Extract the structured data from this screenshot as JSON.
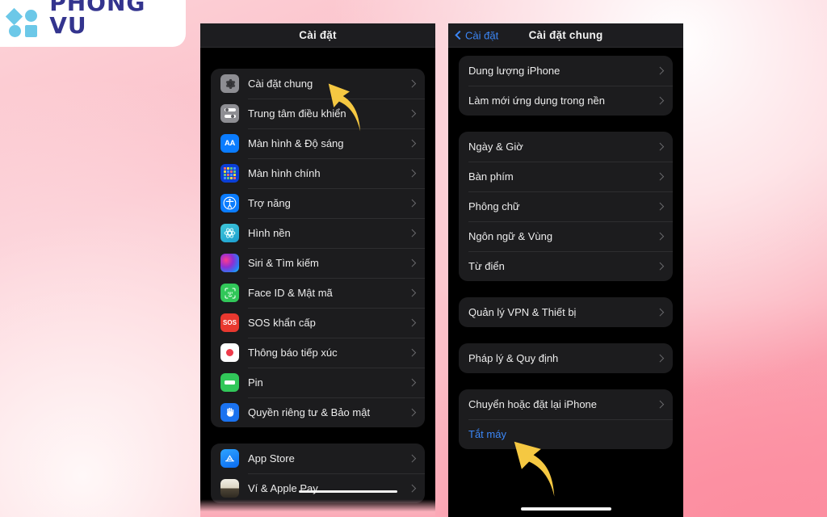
{
  "brand": {
    "name": "PHONG VU",
    "logo_icon": "phong-vu-logo",
    "logo_color": "#33348e",
    "shape_color": "#6cc8e8"
  },
  "background": {
    "gradient_from": "#fcd3d8",
    "gradient_to": "#fb8fa2"
  },
  "phone_left": {
    "nav": {
      "title": "Cài đặt"
    },
    "groups": [
      {
        "rows": [
          {
            "label": "Cài đặt chung",
            "icon": "gear-icon"
          },
          {
            "label": "Trung tâm điều khiển",
            "icon": "control-center-icon"
          },
          {
            "label": "Màn hình & Độ sáng",
            "icon": "display-brightness-icon"
          },
          {
            "label": "Màn hình chính",
            "icon": "home-screen-icon"
          },
          {
            "label": "Trợ năng",
            "icon": "accessibility-icon"
          },
          {
            "label": "Hình nền",
            "icon": "wallpaper-icon"
          },
          {
            "label": "Siri & Tìm kiếm",
            "icon": "siri-icon"
          },
          {
            "label": "Face ID & Mật mã",
            "icon": "face-id-icon"
          },
          {
            "label": "SOS khẩn cấp",
            "icon": "sos-icon"
          },
          {
            "label": "Thông báo tiếp xúc",
            "icon": "exposure-notification-icon"
          },
          {
            "label": "Pin",
            "icon": "battery-icon"
          },
          {
            "label": "Quyền riêng tư & Bảo mật",
            "icon": "privacy-icon"
          }
        ]
      },
      {
        "rows": [
          {
            "label": "App Store",
            "icon": "app-store-icon"
          },
          {
            "label": "Ví & Apple Pay",
            "icon": "wallet-icon"
          }
        ]
      }
    ]
  },
  "phone_right": {
    "nav": {
      "back_label": "Cài đặt",
      "title": "Cài đặt chung"
    },
    "groups": [
      {
        "rows": [
          {
            "label": "Dung lượng iPhone"
          },
          {
            "label": "Làm mới ứng dụng trong nền"
          }
        ]
      },
      {
        "rows": [
          {
            "label": "Ngày & Giờ"
          },
          {
            "label": "Bàn phím"
          },
          {
            "label": "Phông chữ"
          },
          {
            "label": "Ngôn ngữ & Vùng"
          },
          {
            "label": "Từ điển"
          }
        ]
      },
      {
        "rows": [
          {
            "label": "Quản lý VPN & Thiết bị"
          }
        ]
      },
      {
        "rows": [
          {
            "label": "Pháp lý & Quy định"
          }
        ]
      },
      {
        "rows": [
          {
            "label": "Chuyển hoặc đặt lại iPhone"
          },
          {
            "label": "Tắt máy",
            "accent": true
          }
        ]
      }
    ]
  },
  "annotations": {
    "arrow_color": "#f5c842",
    "arrow_1": "curved-arrow-pointing-to-cai-dat-chung",
    "arrow_2": "curved-arrow-pointing-to-tat-may"
  }
}
